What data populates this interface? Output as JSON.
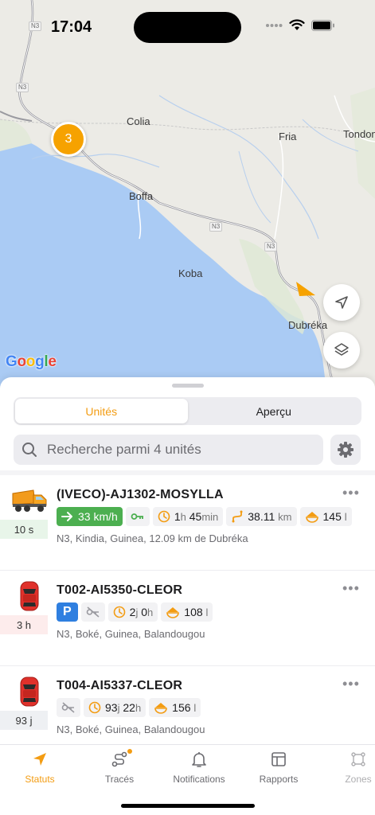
{
  "status_bar": {
    "time": "17:04"
  },
  "map": {
    "places": {
      "colia": "Colia",
      "fria": "Fria",
      "tondon": "Tondon",
      "boffa": "Boffa",
      "koba": "Koba",
      "dubreka": "Dubréka"
    },
    "road_shield": "N3",
    "cluster_count": "3",
    "provider": "Google",
    "accent_color": "#f6a200"
  },
  "sheet": {
    "tabs": [
      {
        "label": "Unités",
        "active": true
      },
      {
        "label": "Aperçu",
        "active": false
      }
    ],
    "search": {
      "placeholder": "Recherche parmi 4 unités"
    },
    "units": [
      {
        "name": "(IVECO)-AJ1302-MOSYLLA",
        "icon": "truck-icon",
        "age": "10 s",
        "speed": "33 km/h",
        "duration_h": "1",
        "duration_h_unit": "h",
        "duration_m": "45",
        "duration_m_unit": "min",
        "distance": "38.11",
        "distance_unit": "km",
        "fuel": "145",
        "fuel_unit": "l",
        "address": "N3, Kindia, Guinea, 12.09 km de Dubréka"
      },
      {
        "name": "T002-AI5350-CLEOR",
        "icon": "car-icon",
        "age": "3 h",
        "parking": "P",
        "duration_d": "2",
        "duration_d_unit": "j",
        "duration_h": "0",
        "duration_h_unit": "h",
        "fuel": "108",
        "fuel_unit": "l",
        "address": "N3, Boké, Guinea, Balandougou"
      },
      {
        "name": "T004-AI5337-CLEOR",
        "icon": "car-icon",
        "age": "93 j",
        "duration_d": "93",
        "duration_d_unit": "j",
        "duration_h": "22",
        "duration_h_unit": "h",
        "fuel": "156",
        "fuel_unit": "l",
        "address": "N3, Boké, Guinea, Balandougou"
      }
    ]
  },
  "tabbar": [
    {
      "label": "Statuts",
      "icon": "navigation-arrow-icon",
      "active": true
    },
    {
      "label": "Tracés",
      "icon": "route-icon",
      "badge": true
    },
    {
      "label": "Notifications",
      "icon": "bell-icon"
    },
    {
      "label": "Rapports",
      "icon": "report-icon"
    },
    {
      "label": "Zones",
      "icon": "geofence-icon"
    }
  ],
  "colors": {
    "accent": "#f39c12",
    "speed_green": "#4caf50",
    "parking_blue": "#2f7fe0",
    "car_red": "#e0312b"
  }
}
